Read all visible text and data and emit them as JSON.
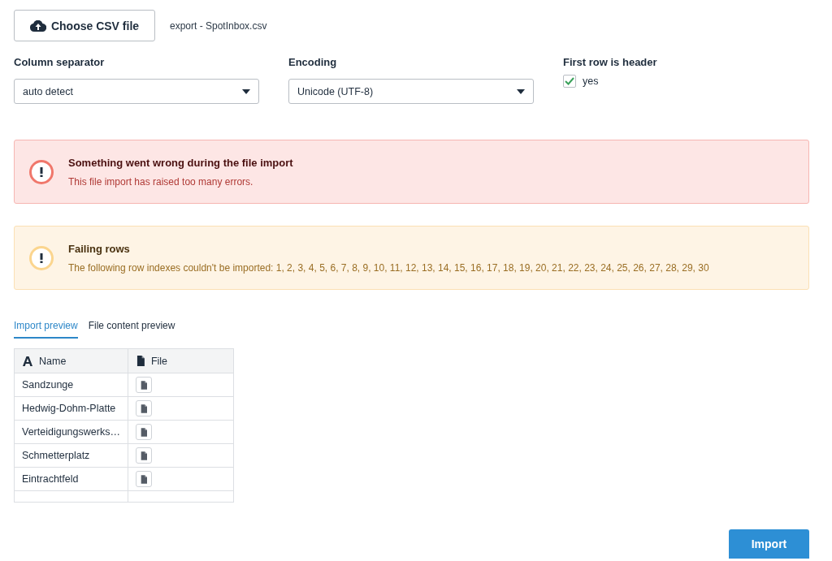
{
  "file_picker": {
    "button": "Choose CSV file",
    "filename": "export - SpotInbox.csv"
  },
  "options": [
    {
      "kind": "select",
      "label": "Column separator",
      "value": "auto detect"
    },
    {
      "kind": "select",
      "label": "Encoding",
      "value": "Unicode (UTF-8)"
    },
    {
      "kind": "checkbox",
      "label": "First row is header",
      "text": "yes",
      "checked": true
    }
  ],
  "alerts": [
    {
      "kind": "error",
      "title": "Something went wrong during the file import",
      "message": "This file import has raised too many errors."
    },
    {
      "kind": "warning",
      "title": "Failing rows",
      "message": "The following row indexes couldn't be imported: 1, 2, 3, 4, 5, 6, 7, 8, 9, 10, 11, 12, 13, 14, 15, 16, 17, 18, 19, 20, 21, 22, 23, 24, 25, 26, 27, 28, 29, 30"
    }
  ],
  "tabs": [
    {
      "label": "Import preview",
      "selected": true
    },
    {
      "label": "File content preview",
      "selected": false
    }
  ],
  "table": {
    "columns": [
      {
        "kind": "text",
        "label": "Name"
      },
      {
        "kind": "file",
        "label": "File"
      }
    ],
    "rows": [
      {
        "name": "Sandzunge"
      },
      {
        "name": "Hedwig-Dohm-Platte"
      },
      {
        "name": "Verteidigungswerks…"
      },
      {
        "name": "Schmetterplatz"
      },
      {
        "name": "Eintrachtfeld"
      }
    ]
  },
  "import_button": "Import"
}
